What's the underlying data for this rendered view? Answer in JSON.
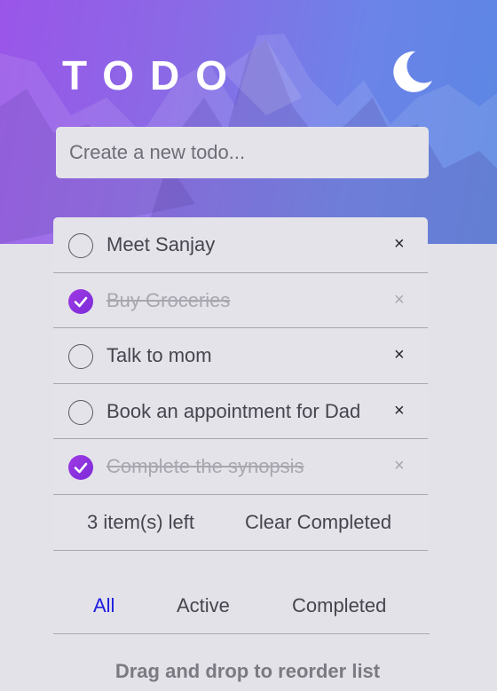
{
  "app": {
    "title": "TODO"
  },
  "new_todo": {
    "placeholder": "Create a new todo..."
  },
  "todos": [
    {
      "label": "Meet Sanjay",
      "completed": false
    },
    {
      "label": "Buy Groceries",
      "completed": true
    },
    {
      "label": "Talk to mom",
      "completed": false
    },
    {
      "label": "Book an appointment for Dad",
      "completed": false
    },
    {
      "label": "Complete the synopsis",
      "completed": true
    }
  ],
  "delete_glyph": "×",
  "footer": {
    "items_left": "3 item(s) left",
    "clear_label": "Clear Completed"
  },
  "filters": {
    "all": "All",
    "active": "Active",
    "completed": "Completed",
    "selected": "All"
  },
  "hint": "Drag and drop to reorder list",
  "colors": {
    "accent_purple": "#8a2be2",
    "filter_selected": "#1d1de0",
    "hero_gradient_start": "#9a55e8",
    "hero_gradient_end": "#5a86e2"
  },
  "icons": {
    "theme": "moon-icon",
    "check": "checkmark-icon",
    "delete": "close-icon"
  }
}
